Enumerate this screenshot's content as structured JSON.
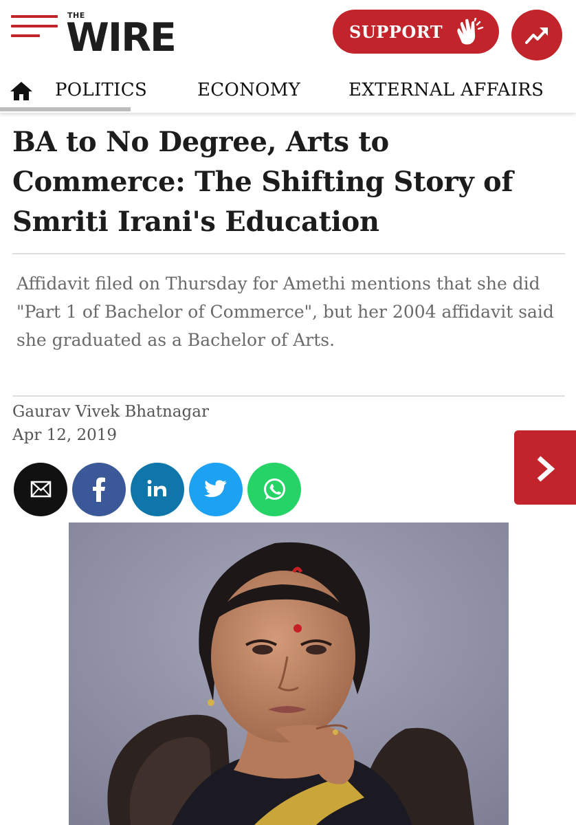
{
  "header": {
    "logo_small": "THE",
    "logo_main": "WIRE",
    "support_label": "SUPPORT",
    "brand_color": "#c2242b",
    "icons": [
      "menu-icon",
      "clapping-hands-icon",
      "trending-icon"
    ]
  },
  "nav": {
    "items": [
      {
        "label": "POLITICS"
      },
      {
        "label": "ECONOMY"
      },
      {
        "label": "EXTERNAL AFFAIRS"
      }
    ],
    "home_icon": "home-icon",
    "active": "POLITICS"
  },
  "article": {
    "headline": "BA to No Degree, Arts to Commerce: The Shifting Story of Smriti Irani's Education",
    "summary": "Affidavit filed on Thursday for Amethi mentions that she did \"Part 1 of Bachelor of Commerce\", but her 2004 affidavit said she graduated as a Bachelor of Arts.",
    "author": "Gaurav Vivek Bhatnagar",
    "date": "Apr 12, 2019"
  },
  "share": {
    "buttons": [
      {
        "icon": "email-icon",
        "color": "#111111"
      },
      {
        "icon": "facebook-icon",
        "color": "#3b5998"
      },
      {
        "icon": "linkedin-icon",
        "color": "#0e76a8"
      },
      {
        "icon": "twitter-icon",
        "color": "#1da1f2"
      },
      {
        "icon": "whatsapp-icon",
        "color": "#25d366"
      }
    ]
  },
  "next_icon": "chevron-right-icon"
}
